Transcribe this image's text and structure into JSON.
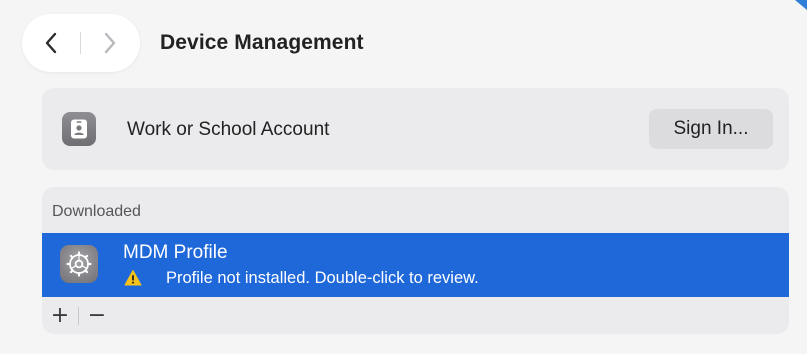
{
  "toolbar": {
    "title": "Device Management",
    "back_icon": "chevron-left-icon",
    "forward_icon": "chevron-right-icon"
  },
  "account": {
    "icon": "id-badge-icon",
    "label": "Work or School Account",
    "sign_in_label": "Sign In..."
  },
  "downloaded": {
    "header": "Downloaded",
    "items": [
      {
        "icon": "gear-icon",
        "title": "MDM Profile",
        "status_icon": "warning-icon",
        "status": "Profile not installed. Double-click to review.",
        "selected": true
      }
    ],
    "add_label": "+",
    "remove_label": "−"
  },
  "colors": {
    "selection": "#1f68d9",
    "warning": "#f4c21b",
    "card_bg": "#ebebed",
    "window_bg": "#f5f5f6"
  }
}
